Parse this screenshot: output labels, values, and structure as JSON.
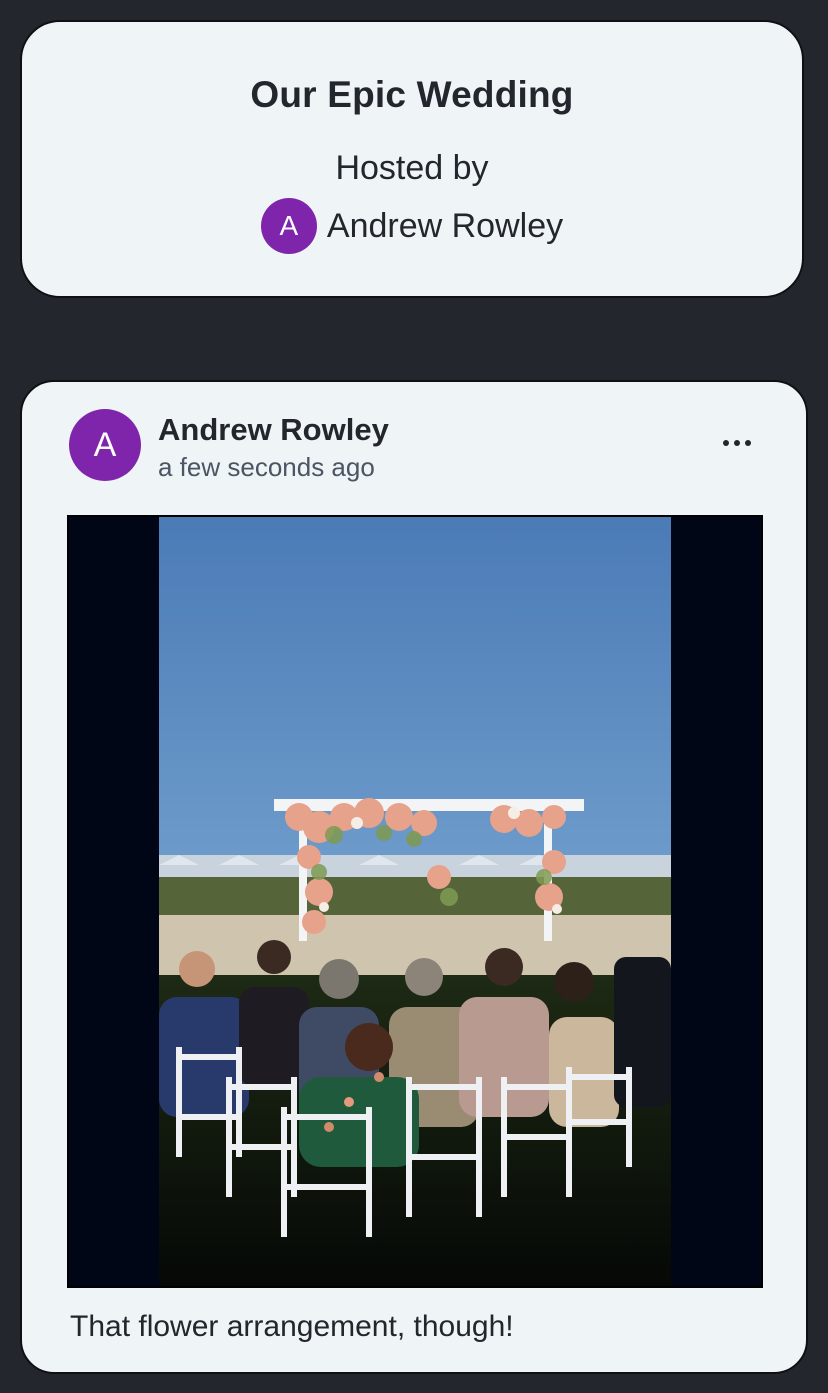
{
  "event": {
    "title": "Our Epic Wedding",
    "hosted_by_label": "Hosted by",
    "host_initial": "A",
    "host_name": "Andrew Rowley"
  },
  "post": {
    "author_initial": "A",
    "author_name": "Andrew Rowley",
    "timestamp": "a few seconds ago",
    "caption": "That flower arrangement, though!",
    "menu_icon": "more-horizontal-icon"
  },
  "colors": {
    "background": "#24262d",
    "card": "#eff4f7",
    "avatar": "#7f25ab",
    "text": "#23262d",
    "muted_text": "#4d5462",
    "photo_letterbox": "#010617"
  }
}
